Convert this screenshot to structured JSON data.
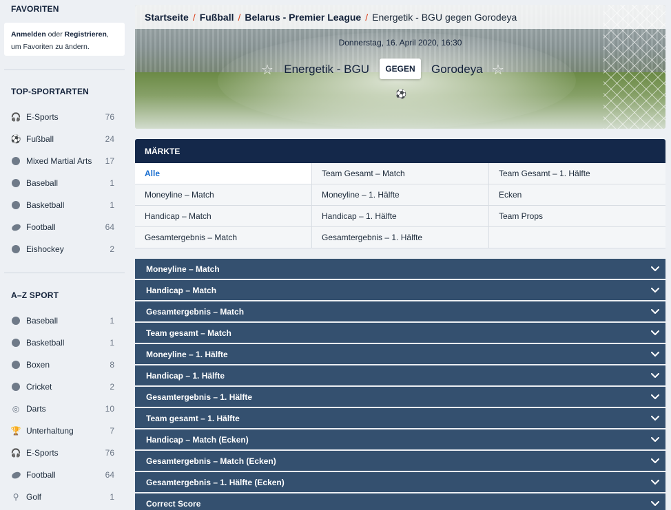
{
  "sidebar": {
    "favorites_title": "FAVORITEN",
    "favorites_box": {
      "login": "Anmelden",
      "or": " oder ",
      "register": "Registrieren",
      "rest": ", um Favoriten zu ändern."
    },
    "top_title": "TOP-SPORTARTEN",
    "top_sports": [
      {
        "name": "E-Sports",
        "count": "76",
        "icon": "headset-icon"
      },
      {
        "name": "Fußball",
        "count": "24",
        "icon": "soccer-ball-icon"
      },
      {
        "name": "Mixed Martial Arts",
        "count": "17",
        "icon": "glove-icon"
      },
      {
        "name": "Baseball",
        "count": "1",
        "icon": "baseball-icon"
      },
      {
        "name": "Basketball",
        "count": "1",
        "icon": "basketball-icon"
      },
      {
        "name": "Football",
        "count": "64",
        "icon": "american-football-icon"
      },
      {
        "name": "Eishockey",
        "count": "2",
        "icon": "puck-icon"
      }
    ],
    "az_title": "A–Z SPORT",
    "az_sports": [
      {
        "name": "Baseball",
        "count": "1",
        "icon": "baseball-icon"
      },
      {
        "name": "Basketball",
        "count": "1",
        "icon": "basketball-icon"
      },
      {
        "name": "Boxen",
        "count": "8",
        "icon": "boxing-glove-icon"
      },
      {
        "name": "Cricket",
        "count": "2",
        "icon": "cricket-ball-icon"
      },
      {
        "name": "Darts",
        "count": "10",
        "icon": "dartboard-icon"
      },
      {
        "name": "Unterhaltung",
        "count": "7",
        "icon": "trophy-icon"
      },
      {
        "name": "E-Sports",
        "count": "76",
        "icon": "headset-icon"
      },
      {
        "name": "Football",
        "count": "64",
        "icon": "american-football-icon"
      },
      {
        "name": "Golf",
        "count": "1",
        "icon": "golf-icon"
      }
    ]
  },
  "breadcrumb": [
    {
      "label": "Startseite"
    },
    {
      "label": "Fußball"
    },
    {
      "label": "Belarus - Premier League"
    },
    {
      "label": "Energetik - BGU gegen Gorodeya"
    }
  ],
  "match": {
    "datetime": "Donnerstag, 16. April 2020, 16:30",
    "home": "Energetik - BGU",
    "vs_label": "GEGEN",
    "away": "Gorodeya"
  },
  "markets": {
    "title": "MÄRKTE",
    "tabs": [
      "Alle",
      "Team Gesamt – Match",
      "Team Gesamt – 1. Hälfte",
      "Moneyline – Match",
      "Moneyline – 1. Hälfte",
      "Ecken",
      "Handicap – Match",
      "Handicap – 1. Hälfte",
      "Team Props",
      "Gesamtergebnis – Match",
      "Gesamtergebnis – 1. Hälfte",
      ""
    ],
    "active_tab": "Alle"
  },
  "sections": [
    "Moneyline – Match",
    "Handicap – Match",
    "Gesamtergebnis – Match",
    "Team gesamt – Match",
    "Moneyline – 1. Hälfte",
    "Handicap – 1. Hälfte",
    "Gesamtergebnis – 1. Hälfte",
    "Team gesamt – 1. Hälfte",
    "Handicap – Match (Ecken)",
    "Gesamtergebnis – Match (Ecken)",
    "Gesamtergebnis – 1. Hälfte (Ecken)",
    "Correct Score"
  ],
  "colors": {
    "accent_link": "#1a6fd0",
    "header_dark": "#14284a",
    "section_bar": "#34506f",
    "breadcrumb_sep": "#d9401a"
  }
}
